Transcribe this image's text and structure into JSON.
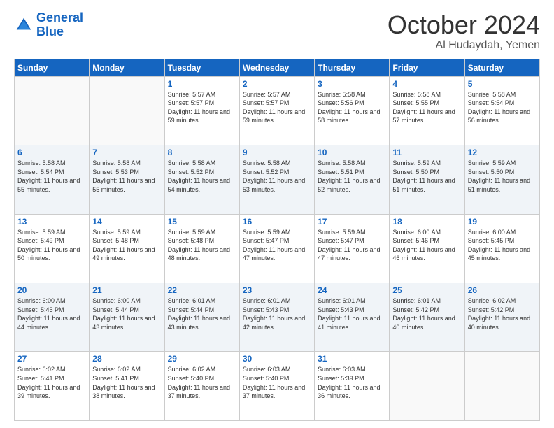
{
  "header": {
    "logo_line1": "General",
    "logo_line2": "Blue",
    "month": "October 2024",
    "location": "Al Hudaydah, Yemen"
  },
  "days_of_week": [
    "Sunday",
    "Monday",
    "Tuesday",
    "Wednesday",
    "Thursday",
    "Friday",
    "Saturday"
  ],
  "weeks": [
    [
      {
        "day": "",
        "sunrise": "",
        "sunset": "",
        "daylight": ""
      },
      {
        "day": "",
        "sunrise": "",
        "sunset": "",
        "daylight": ""
      },
      {
        "day": "1",
        "sunrise": "Sunrise: 5:57 AM",
        "sunset": "Sunset: 5:57 PM",
        "daylight": "Daylight: 11 hours and 59 minutes."
      },
      {
        "day": "2",
        "sunrise": "Sunrise: 5:57 AM",
        "sunset": "Sunset: 5:57 PM",
        "daylight": "Daylight: 11 hours and 59 minutes."
      },
      {
        "day": "3",
        "sunrise": "Sunrise: 5:58 AM",
        "sunset": "Sunset: 5:56 PM",
        "daylight": "Daylight: 11 hours and 58 minutes."
      },
      {
        "day": "4",
        "sunrise": "Sunrise: 5:58 AM",
        "sunset": "Sunset: 5:55 PM",
        "daylight": "Daylight: 11 hours and 57 minutes."
      },
      {
        "day": "5",
        "sunrise": "Sunrise: 5:58 AM",
        "sunset": "Sunset: 5:54 PM",
        "daylight": "Daylight: 11 hours and 56 minutes."
      }
    ],
    [
      {
        "day": "6",
        "sunrise": "Sunrise: 5:58 AM",
        "sunset": "Sunset: 5:54 PM",
        "daylight": "Daylight: 11 hours and 55 minutes."
      },
      {
        "day": "7",
        "sunrise": "Sunrise: 5:58 AM",
        "sunset": "Sunset: 5:53 PM",
        "daylight": "Daylight: 11 hours and 55 minutes."
      },
      {
        "day": "8",
        "sunrise": "Sunrise: 5:58 AM",
        "sunset": "Sunset: 5:52 PM",
        "daylight": "Daylight: 11 hours and 54 minutes."
      },
      {
        "day": "9",
        "sunrise": "Sunrise: 5:58 AM",
        "sunset": "Sunset: 5:52 PM",
        "daylight": "Daylight: 11 hours and 53 minutes."
      },
      {
        "day": "10",
        "sunrise": "Sunrise: 5:58 AM",
        "sunset": "Sunset: 5:51 PM",
        "daylight": "Daylight: 11 hours and 52 minutes."
      },
      {
        "day": "11",
        "sunrise": "Sunrise: 5:59 AM",
        "sunset": "Sunset: 5:50 PM",
        "daylight": "Daylight: 11 hours and 51 minutes."
      },
      {
        "day": "12",
        "sunrise": "Sunrise: 5:59 AM",
        "sunset": "Sunset: 5:50 PM",
        "daylight": "Daylight: 11 hours and 51 minutes."
      }
    ],
    [
      {
        "day": "13",
        "sunrise": "Sunrise: 5:59 AM",
        "sunset": "Sunset: 5:49 PM",
        "daylight": "Daylight: 11 hours and 50 minutes."
      },
      {
        "day": "14",
        "sunrise": "Sunrise: 5:59 AM",
        "sunset": "Sunset: 5:48 PM",
        "daylight": "Daylight: 11 hours and 49 minutes."
      },
      {
        "day": "15",
        "sunrise": "Sunrise: 5:59 AM",
        "sunset": "Sunset: 5:48 PM",
        "daylight": "Daylight: 11 hours and 48 minutes."
      },
      {
        "day": "16",
        "sunrise": "Sunrise: 5:59 AM",
        "sunset": "Sunset: 5:47 PM",
        "daylight": "Daylight: 11 hours and 47 minutes."
      },
      {
        "day": "17",
        "sunrise": "Sunrise: 5:59 AM",
        "sunset": "Sunset: 5:47 PM",
        "daylight": "Daylight: 11 hours and 47 minutes."
      },
      {
        "day": "18",
        "sunrise": "Sunrise: 6:00 AM",
        "sunset": "Sunset: 5:46 PM",
        "daylight": "Daylight: 11 hours and 46 minutes."
      },
      {
        "day": "19",
        "sunrise": "Sunrise: 6:00 AM",
        "sunset": "Sunset: 5:45 PM",
        "daylight": "Daylight: 11 hours and 45 minutes."
      }
    ],
    [
      {
        "day": "20",
        "sunrise": "Sunrise: 6:00 AM",
        "sunset": "Sunset: 5:45 PM",
        "daylight": "Daylight: 11 hours and 44 minutes."
      },
      {
        "day": "21",
        "sunrise": "Sunrise: 6:00 AM",
        "sunset": "Sunset: 5:44 PM",
        "daylight": "Daylight: 11 hours and 43 minutes."
      },
      {
        "day": "22",
        "sunrise": "Sunrise: 6:01 AM",
        "sunset": "Sunset: 5:44 PM",
        "daylight": "Daylight: 11 hours and 43 minutes."
      },
      {
        "day": "23",
        "sunrise": "Sunrise: 6:01 AM",
        "sunset": "Sunset: 5:43 PM",
        "daylight": "Daylight: 11 hours and 42 minutes."
      },
      {
        "day": "24",
        "sunrise": "Sunrise: 6:01 AM",
        "sunset": "Sunset: 5:43 PM",
        "daylight": "Daylight: 11 hours and 41 minutes."
      },
      {
        "day": "25",
        "sunrise": "Sunrise: 6:01 AM",
        "sunset": "Sunset: 5:42 PM",
        "daylight": "Daylight: 11 hours and 40 minutes."
      },
      {
        "day": "26",
        "sunrise": "Sunrise: 6:02 AM",
        "sunset": "Sunset: 5:42 PM",
        "daylight": "Daylight: 11 hours and 40 minutes."
      }
    ],
    [
      {
        "day": "27",
        "sunrise": "Sunrise: 6:02 AM",
        "sunset": "Sunset: 5:41 PM",
        "daylight": "Daylight: 11 hours and 39 minutes."
      },
      {
        "day": "28",
        "sunrise": "Sunrise: 6:02 AM",
        "sunset": "Sunset: 5:41 PM",
        "daylight": "Daylight: 11 hours and 38 minutes."
      },
      {
        "day": "29",
        "sunrise": "Sunrise: 6:02 AM",
        "sunset": "Sunset: 5:40 PM",
        "daylight": "Daylight: 11 hours and 37 minutes."
      },
      {
        "day": "30",
        "sunrise": "Sunrise: 6:03 AM",
        "sunset": "Sunset: 5:40 PM",
        "daylight": "Daylight: 11 hours and 37 minutes."
      },
      {
        "day": "31",
        "sunrise": "Sunrise: 6:03 AM",
        "sunset": "Sunset: 5:39 PM",
        "daylight": "Daylight: 11 hours and 36 minutes."
      },
      {
        "day": "",
        "sunrise": "",
        "sunset": "",
        "daylight": ""
      },
      {
        "day": "",
        "sunrise": "",
        "sunset": "",
        "daylight": ""
      }
    ]
  ]
}
